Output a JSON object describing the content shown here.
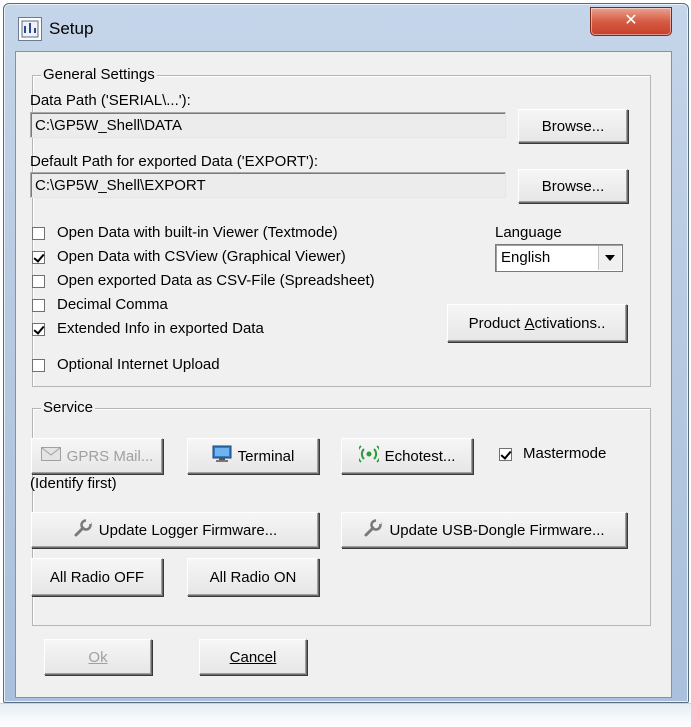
{
  "window": {
    "title": "Setup",
    "close_label": "✕"
  },
  "general": {
    "legend": "General Settings",
    "data_path_label": "Data Path ('SERIAL\\...'):",
    "data_path_value": "C:\\GP5W_Shell\\DATA",
    "export_path_label": "Default Path for exported Data ('EXPORT'):",
    "export_path_value": "C:\\GP5W_Shell\\EXPORT",
    "browse_label": "Browse...",
    "options": [
      {
        "label": "Open Data with built-in Viewer (Textmode)",
        "checked": false
      },
      {
        "label": "Open Data with CSView (Graphical Viewer)",
        "checked": true
      },
      {
        "label": "Open exported Data as CSV-File (Spreadsheet)",
        "checked": false
      },
      {
        "label": "Decimal Comma",
        "checked": false
      },
      {
        "label": "Extended Info in exported Data",
        "checked": true
      },
      {
        "label": "Optional Internet Upload",
        "checked": false
      }
    ],
    "language_label": "Language",
    "language_value": "English",
    "product_activations_pre": "Product ",
    "product_activations_ul": "A",
    "product_activations_post": "ctivations.."
  },
  "service": {
    "legend": "Service",
    "gprs_mail_label": "GPRS Mail...",
    "identify_note": "(Identify first)",
    "terminal_label": "Terminal",
    "echotest_label": "Echotest...",
    "mastermode_label": "Mastermode",
    "mastermode_checked": true,
    "update_logger_label": "Update Logger Firmware...",
    "update_dongle_label": "Update USB-Dongle Firmware...",
    "all_radio_off_label": "All Radio OFF",
    "all_radio_on_label": "All Radio ON"
  },
  "footer": {
    "ok_label": "Ok",
    "cancel_label": "Cancel"
  },
  "colors": {
    "titlebar": "#b9cbe2",
    "close": "#d65c43",
    "dialog": "#f0f0f0"
  }
}
